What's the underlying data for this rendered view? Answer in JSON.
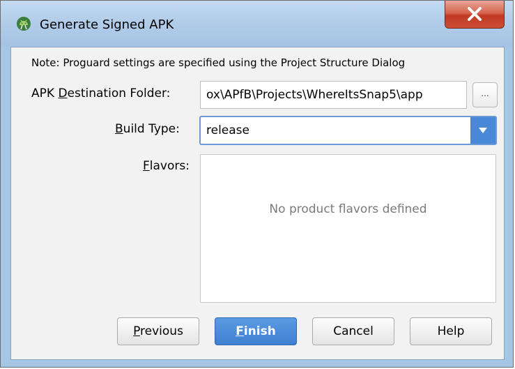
{
  "window": {
    "title": "Generate Signed APK",
    "icon": "android-studio-icon",
    "close_icon": "close-icon"
  },
  "note": "Note: Proguard settings are specified using the Project Structure Dialog",
  "destination": {
    "label_pre": "APK ",
    "label_mnemonic": "D",
    "label_post": "estination Folder:",
    "value": "ox\\APfB\\Projects\\WhereItsSnap5\\app",
    "browse_label": "..."
  },
  "build_type": {
    "label_mnemonic": "B",
    "label_post": "uild Type:",
    "value": "release",
    "arrow_icon": "chevron-down-icon"
  },
  "flavors": {
    "label_mnemonic": "F",
    "label_post": "lavors:",
    "empty_text": "No product flavors defined"
  },
  "buttons": {
    "previous_mnemonic": "P",
    "previous_post": "revious",
    "finish_mnemonic": "F",
    "finish_post": "inish",
    "cancel": "Cancel",
    "help": "Help"
  },
  "colors": {
    "accent": "#4a88d8",
    "title_bar": "#b2cde9",
    "close_button": "#c13a22"
  }
}
